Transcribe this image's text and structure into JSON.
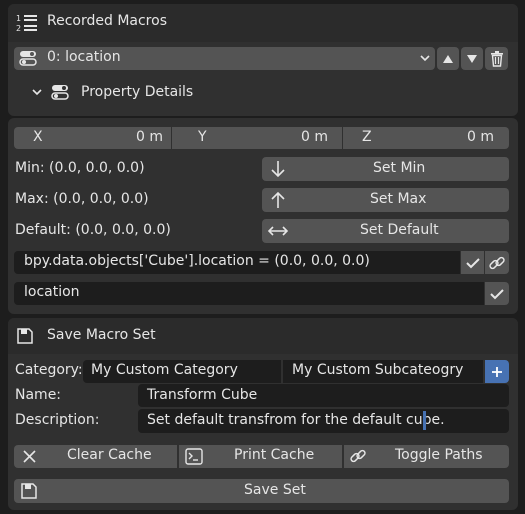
{
  "recorded": {
    "title": "Recorded Macros",
    "dropdown_value": "0: location",
    "property_details_label": "Property Details"
  },
  "vector": {
    "x_label": "X",
    "x_value": "0 m",
    "y_label": "Y",
    "y_value": "0 m",
    "z_label": "Z",
    "z_value": "0 m"
  },
  "rows": {
    "min_label": "Min: (0.0, 0.0, 0.0)",
    "max_label": "Max: (0.0, 0.0, 0.0)",
    "default_label": "Default: (0.0, 0.0, 0.0)",
    "set_min": "Set Min",
    "set_max": "Set Max",
    "set_default": "Set Default"
  },
  "command": {
    "expression": "bpy.data.objects['Cube'].location = (0.0, 0.0, 0.0)",
    "name_value": "location"
  },
  "save": {
    "title": "Save Macro Set",
    "category_label": "Category:",
    "category_value": "My Custom Category",
    "subcategory_value": "My Custom Subcateogry",
    "name_label": "Name:",
    "name_value": "Transform Cube",
    "description_label": "Description:",
    "description_value": "Set default transfrom for the default cube.",
    "clear_cache": "Clear Cache",
    "print_cache": "Print Cache",
    "toggle_paths": "Toggle Paths",
    "save_set": "Save Set"
  },
  "colors": {
    "panel_bg": "#303030",
    "field_bg": "#545454",
    "dark_field_bg": "#1d1d1d",
    "accent_blue": "#4772b3"
  }
}
